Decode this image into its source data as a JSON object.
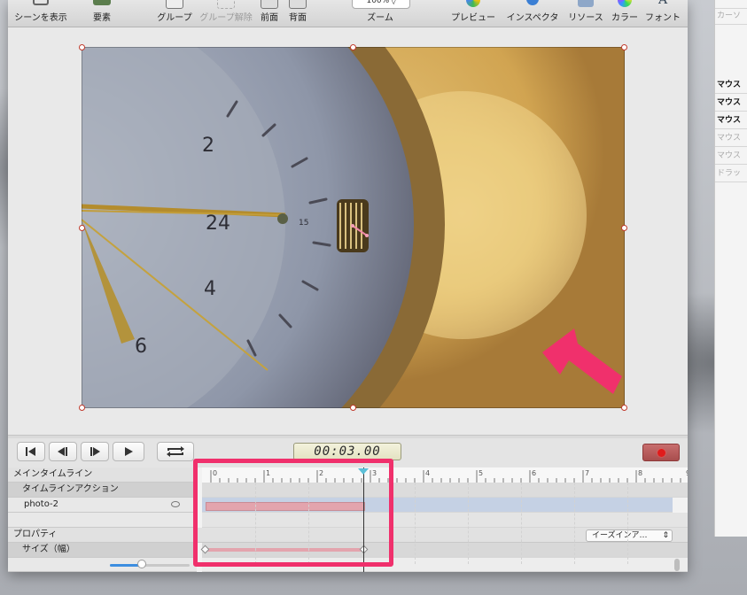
{
  "toolbar": {
    "items": [
      {
        "label": "シーンを表示",
        "icon": "scene-icon"
      },
      {
        "label": "要素",
        "icon": "elements-icon"
      },
      {
        "label": "グループ",
        "icon": "group-icon"
      },
      {
        "label": "グループ解除",
        "icon": "ungroup-icon"
      },
      {
        "label": "前面",
        "icon": "bring-front-icon"
      },
      {
        "label": "背面",
        "icon": "send-back-icon"
      },
      {
        "label": "ズーム",
        "icon": "zoom-icon"
      },
      {
        "label": "プレビュー",
        "icon": "preview-icon"
      },
      {
        "label": "インスペクタ",
        "icon": "inspector-icon"
      },
      {
        "label": "リソース",
        "icon": "resources-icon"
      },
      {
        "label": "カラー",
        "icon": "color-icon"
      },
      {
        "label": "フォント",
        "icon": "font-icon"
      }
    ],
    "zoom_value": "100% ◊"
  },
  "transport": {
    "time": "00:03.00"
  },
  "timeline": {
    "main_timeline": "メインタイムライン",
    "timeline_action": "タイムラインアクション",
    "element_name": "photo-2",
    "properties": "プロパティ",
    "property_name": "サイズ（幅）",
    "ease_option": "イーズインア…",
    "ruler_labels": [
      "0",
      "1",
      "2",
      "3",
      "4",
      "5",
      "6",
      "7",
      "8",
      "9"
    ]
  },
  "side_panel": {
    "rows": [
      {
        "label": "カーソ",
        "style": "dim"
      },
      {
        "label": "マウス",
        "style": "bold"
      },
      {
        "label": "マウス",
        "style": "bold"
      },
      {
        "label": "マウス",
        "style": "bold"
      },
      {
        "label": "マウス",
        "style": "dim"
      },
      {
        "label": "マウス",
        "style": "dim"
      },
      {
        "label": "ドラッ",
        "style": "dim"
      }
    ]
  },
  "colors": {
    "highlight": "#f0306c",
    "arrow": "#f0306c",
    "track_bar": "#e3a4ad",
    "track_lane": "#c5d1e4",
    "playhead_cap": "#5cc0d8",
    "record": "#e01b1b"
  }
}
